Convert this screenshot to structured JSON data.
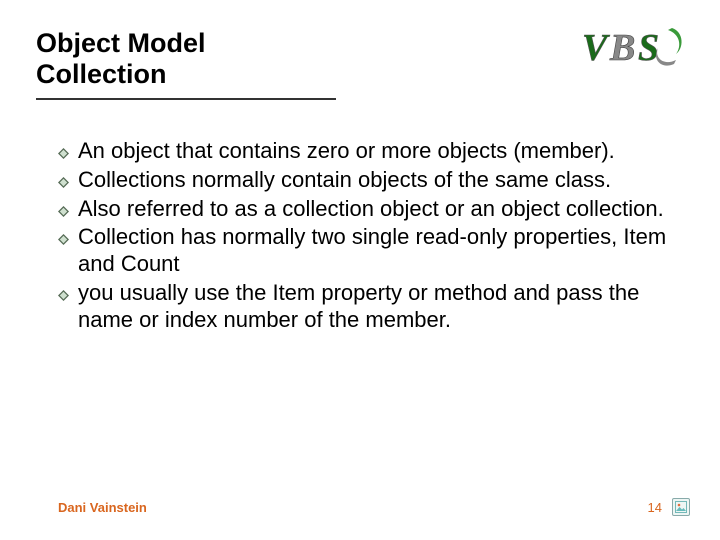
{
  "header": {
    "title_line1": "Object Model",
    "title_line2": "Collection"
  },
  "logo": {
    "text": "VBS"
  },
  "bullets": [
    "An object that contains zero or more objects (member).",
    "Collections normally contain objects of the same class.",
    "Also referred to as a collection object or an object collection.",
    "Collection has normally two single read-only properties, Item and Count",
    "you usually use the Item property or method and pass the name or index number of the member."
  ],
  "footer": {
    "author": "Dani Vainstein",
    "page": "14"
  }
}
